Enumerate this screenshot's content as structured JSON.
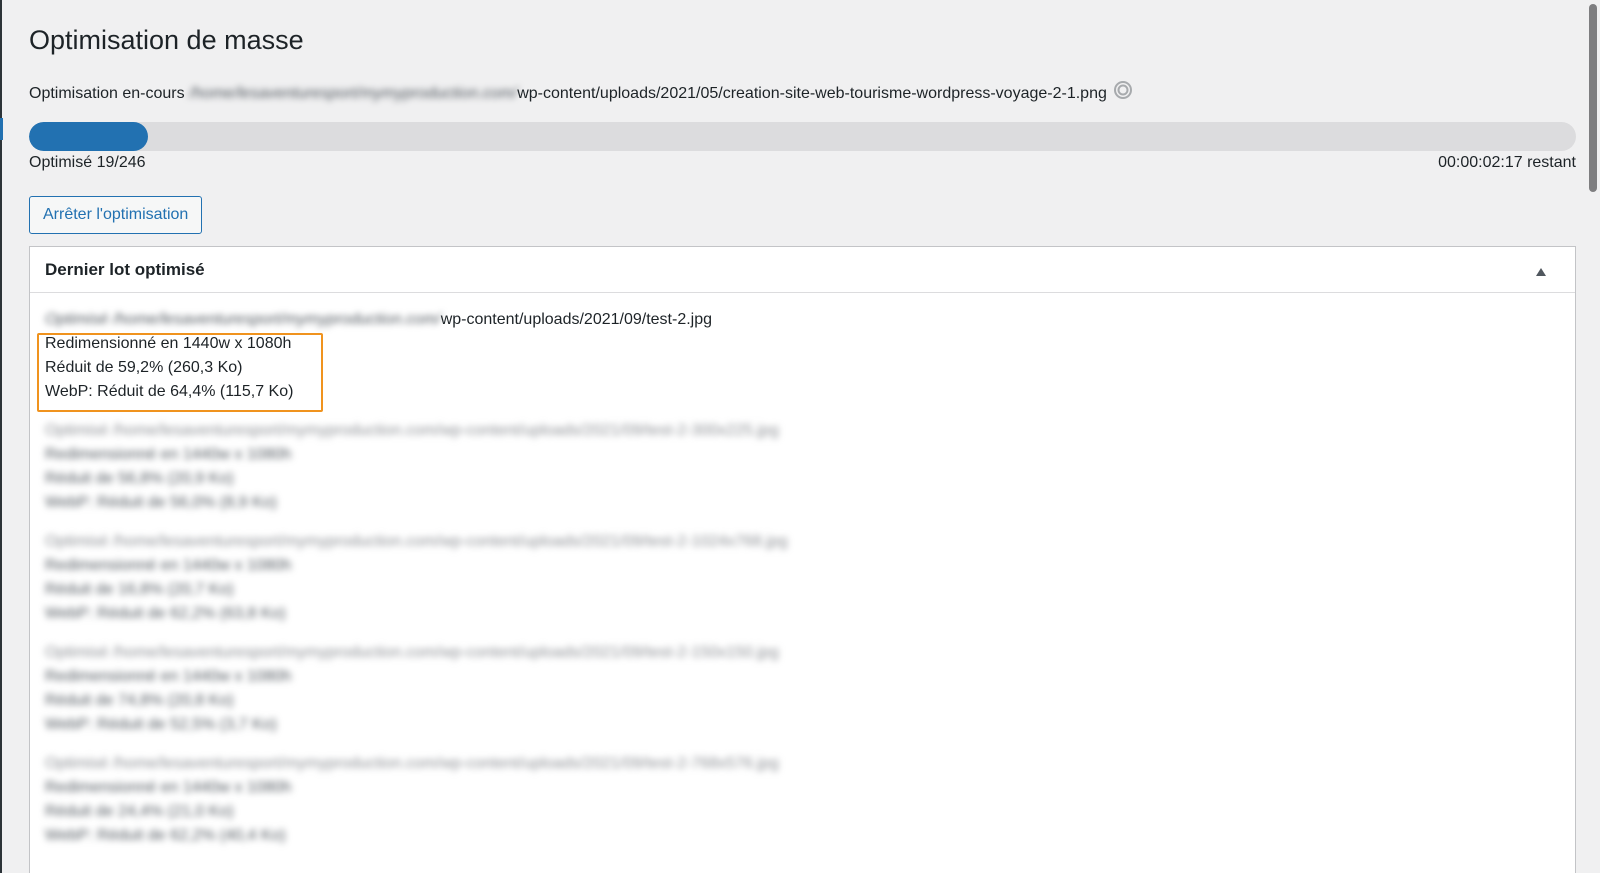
{
  "page": {
    "title": "Optimisation de masse",
    "progress_prefix": "Optimisation en-cours",
    "progress_path_hidden": "/home/lesaventuresport/mymyproduction.com/",
    "progress_path": "wp-content/uploads/2021/05/creation-site-web-tourisme-wordpress-voyage-2-1.png",
    "progress_percent": 7.7,
    "optimized_count": "Optimisé 19/246",
    "time_remaining": "00:00:02:17 restant",
    "stop_button": "Arrêter l'optimisation"
  },
  "panel": {
    "title": "Dernier lot optimisé",
    "entries": [
      {
        "path_hidden": "Optimisé /home/lesaventuresport/mymyproduction.com/",
        "path": "wp-content/uploads/2021/09/test-2.jpg",
        "lines": [
          "Redimensionné en 1440w x 1080h",
          "Réduit de 59,2% (260,3 Ko)",
          "WebP: Réduit de 64,4% (115,7 Ko)"
        ]
      },
      {
        "path_hidden": "Optimisé /home/lesaventuresport/mymyproduction.com/wp-content/uploads/2021/09/test-2-300x225.jpg",
        "lines": [
          "Redimensionné en 1440w x 1080h",
          "Réduit de 56,8% (20,9 Ko)",
          "WebP: Réduit de 56,0% (8,9 Ko)"
        ]
      },
      {
        "path_hidden": "Optimisé /home/lesaventuresport/mymyproduction.com/wp-content/uploads/2021/09/test-2-1024x768.jpg",
        "lines": [
          "Redimensionné en 1440w x 1080h",
          "Réduit de 16,8% (20,7 Ko)",
          "WebP: Réduit de 62,2% (63,8 Ko)"
        ]
      },
      {
        "path_hidden": "Optimisé /home/lesaventuresport/mymyproduction.com/wp-content/uploads/2021/09/test-2-150x150.jpg",
        "lines": [
          "Redimensionné en 1440w x 1080h",
          "Réduit de 74,8% (20,8 Ko)",
          "WebP: Réduit de 52,5% (3,7 Ko)"
        ]
      },
      {
        "path_hidden": "Optimisé /home/lesaventuresport/mymyproduction.com/wp-content/uploads/2021/09/test-2-768x576.jpg",
        "lines": [
          "Redimensionné en 1440w x 1080h",
          "Réduit de 24,4% (21,0 Ko)",
          "WebP: Réduit de 62,2% (40,4 Ko)"
        ]
      }
    ]
  },
  "colors": {
    "accent": "#2271b1",
    "highlight": "#f0931e",
    "background": "#f0f0f1"
  },
  "icons": {
    "spinner": "spinner-icon",
    "toggle": "triangle-up-icon"
  }
}
